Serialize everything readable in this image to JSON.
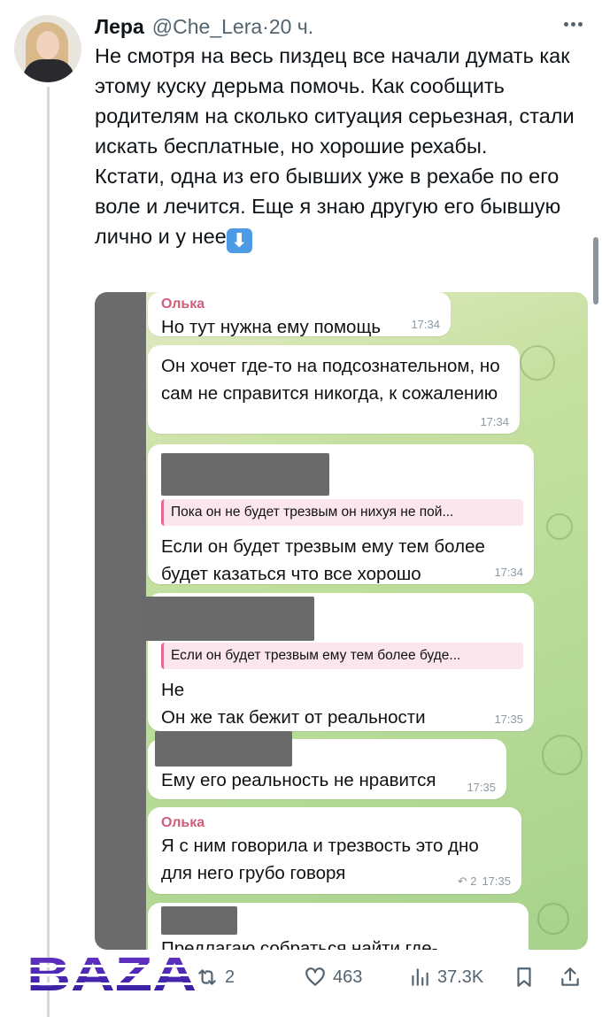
{
  "author": {
    "name": "Лера",
    "handle": "@Che_Lera",
    "separator": "·",
    "time": "20 ч."
  },
  "tweet": {
    "paragraphs": [
      "Не смотря на весь пиздец все начали думать как этому куску дерьма помочь. Как сообщить родителям на сколько ситуация серьезная, стали искать бесплатные, но хорошие рехабы.",
      "Кстати, одна из его бывших уже в рехабе по его воле и лечится. Еще я знаю другую его бывшую лично и у нее"
    ],
    "emoji": "⬇"
  },
  "chat": {
    "messages": [
      {
        "sender": "Олька",
        "text": "Но тут нужна ему помощь",
        "time": "17:34"
      },
      {
        "text": "Он хочет где-то на подсознательном, но сам не справится никогда, к сожалению",
        "time": "17:34"
      },
      {
        "quote": "Пока он не будет трезвым он нихуя не пой...",
        "text": "Если он будет трезвым ему тем более будет казаться что все хорошо",
        "time": "17:34"
      },
      {
        "quote": "Если он будет трезвым ему тем более буде...",
        "line1": "Не",
        "line2": "Он же так бежит от реальности",
        "time": "17:35"
      },
      {
        "text": "Ему его реальность не нравится",
        "time": "17:35"
      },
      {
        "sender": "Олька",
        "text": "Я с ним говорила и трезвость это дно для него грубо говоря",
        "replies": "2",
        "time": "17:35"
      },
      {
        "text": "Предлагаю собраться,найти где-"
      }
    ]
  },
  "actions": {
    "retweets": "2",
    "likes": "463",
    "views": "37.3K"
  },
  "watermark": "BAZA"
}
